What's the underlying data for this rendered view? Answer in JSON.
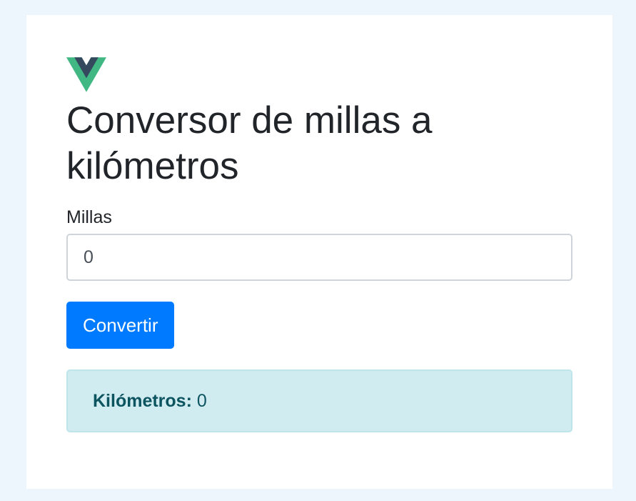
{
  "header": {
    "logo_icon": "vue-logo-icon",
    "title": "Conversor de millas a kilómetros"
  },
  "form": {
    "miles_label": "Millas",
    "miles_value": "0",
    "convert_button": "Convertir"
  },
  "result": {
    "label": "Kilómetros:",
    "value": "0"
  },
  "colors": {
    "page_background": "#eef6fd",
    "primary": "#007bff",
    "alert_background": "#d1ecf1",
    "alert_text": "#0c5460",
    "vue_green": "#41b883",
    "vue_dark": "#35495e"
  }
}
